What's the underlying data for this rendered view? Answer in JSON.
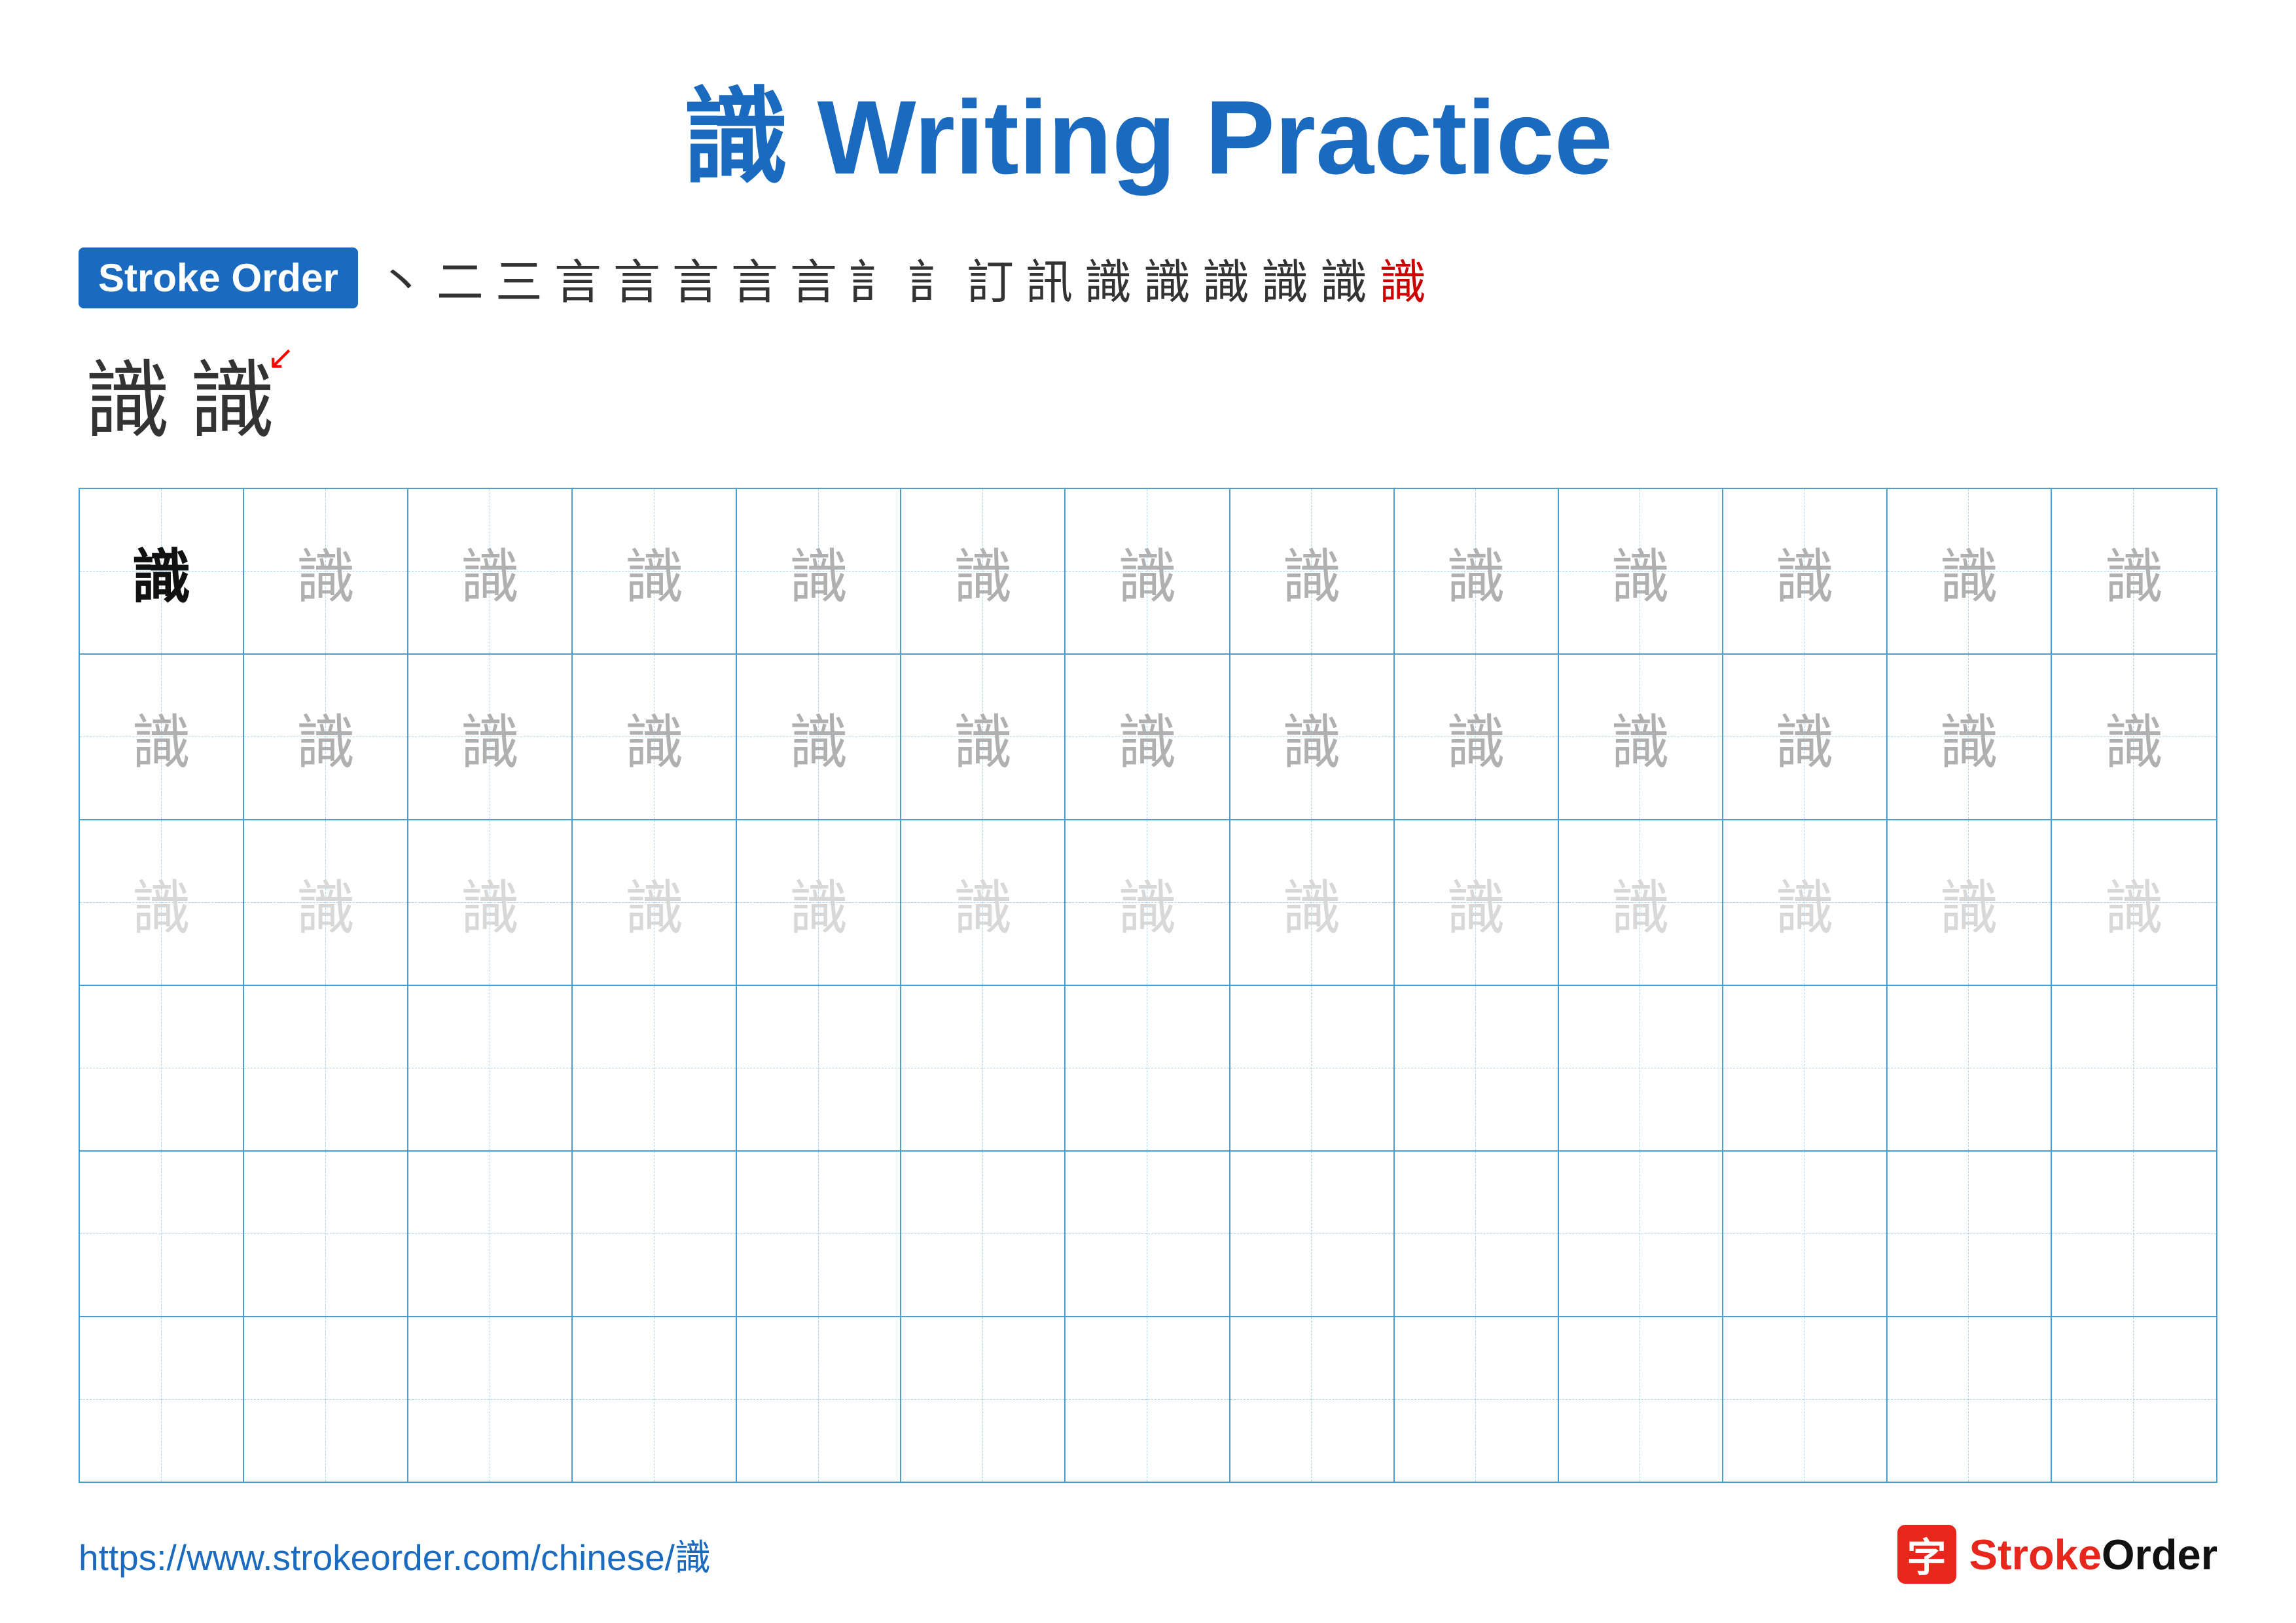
{
  "title": "識 Writing Practice",
  "stroke_order_badge": "Stroke Order",
  "stroke_sequence": [
    "丶",
    "二",
    "三",
    "言",
    "言",
    "言",
    "言",
    "言",
    "訁",
    "訁",
    "訂",
    "訊",
    "識",
    "識",
    "識",
    "識",
    "識",
    "識"
  ],
  "preview_chars": [
    "識",
    "識"
  ],
  "grid": {
    "rows": 6,
    "cols": 13,
    "char": "識",
    "row_styles": [
      "dark_first",
      "medium_all",
      "light_all",
      "empty",
      "empty",
      "empty"
    ]
  },
  "footer": {
    "url": "https://www.strokeorder.com/chinese/識",
    "logo_icon": "字",
    "logo_text": "StrokeOrder"
  }
}
